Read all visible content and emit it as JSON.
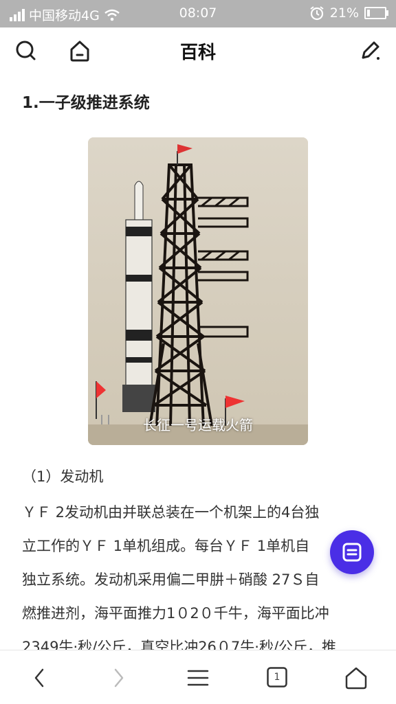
{
  "status_bar": {
    "carrier": "中国移动4G",
    "time": "08:07",
    "battery_percent": "21%",
    "battery_level": 0.21,
    "icons": [
      "signal-icon",
      "wifi-icon",
      "alarm-icon",
      "battery-icon"
    ]
  },
  "top_bar": {
    "title": "百科",
    "icons": [
      "search-icon",
      "home-icon",
      "edit-icon"
    ]
  },
  "article": {
    "section_title": "1.一子级推进系统",
    "image_caption": "长征一号运载火箭",
    "subheading": "（1）发动机",
    "paragraph_lines": [
      "ＹＦ 2发动机由并联总装在一个机架上的4台独",
      "立工作的ＹＦ 1单机组成。每台ＹＦ 1单机自",
      "独立系统。发动机采用偏二甲肼＋硝酸 27Ｓ自",
      "燃推进剂，海平面推力1０2０千牛，海平面比冲",
      "2349牛·秒/公斤，真空比冲26０7牛·秒/公斤，推"
    ]
  },
  "fab": {
    "icon": "note-icon"
  },
  "bottom_bar": {
    "tab_count": "1",
    "icons": [
      "back-icon",
      "forward-icon",
      "menu-icon",
      "tabs-icon",
      "home-icon"
    ]
  },
  "colors": {
    "status_bar_bg": "#b3b3b3",
    "fab_bg": "#4a2ee6",
    "text": "#333333"
  }
}
